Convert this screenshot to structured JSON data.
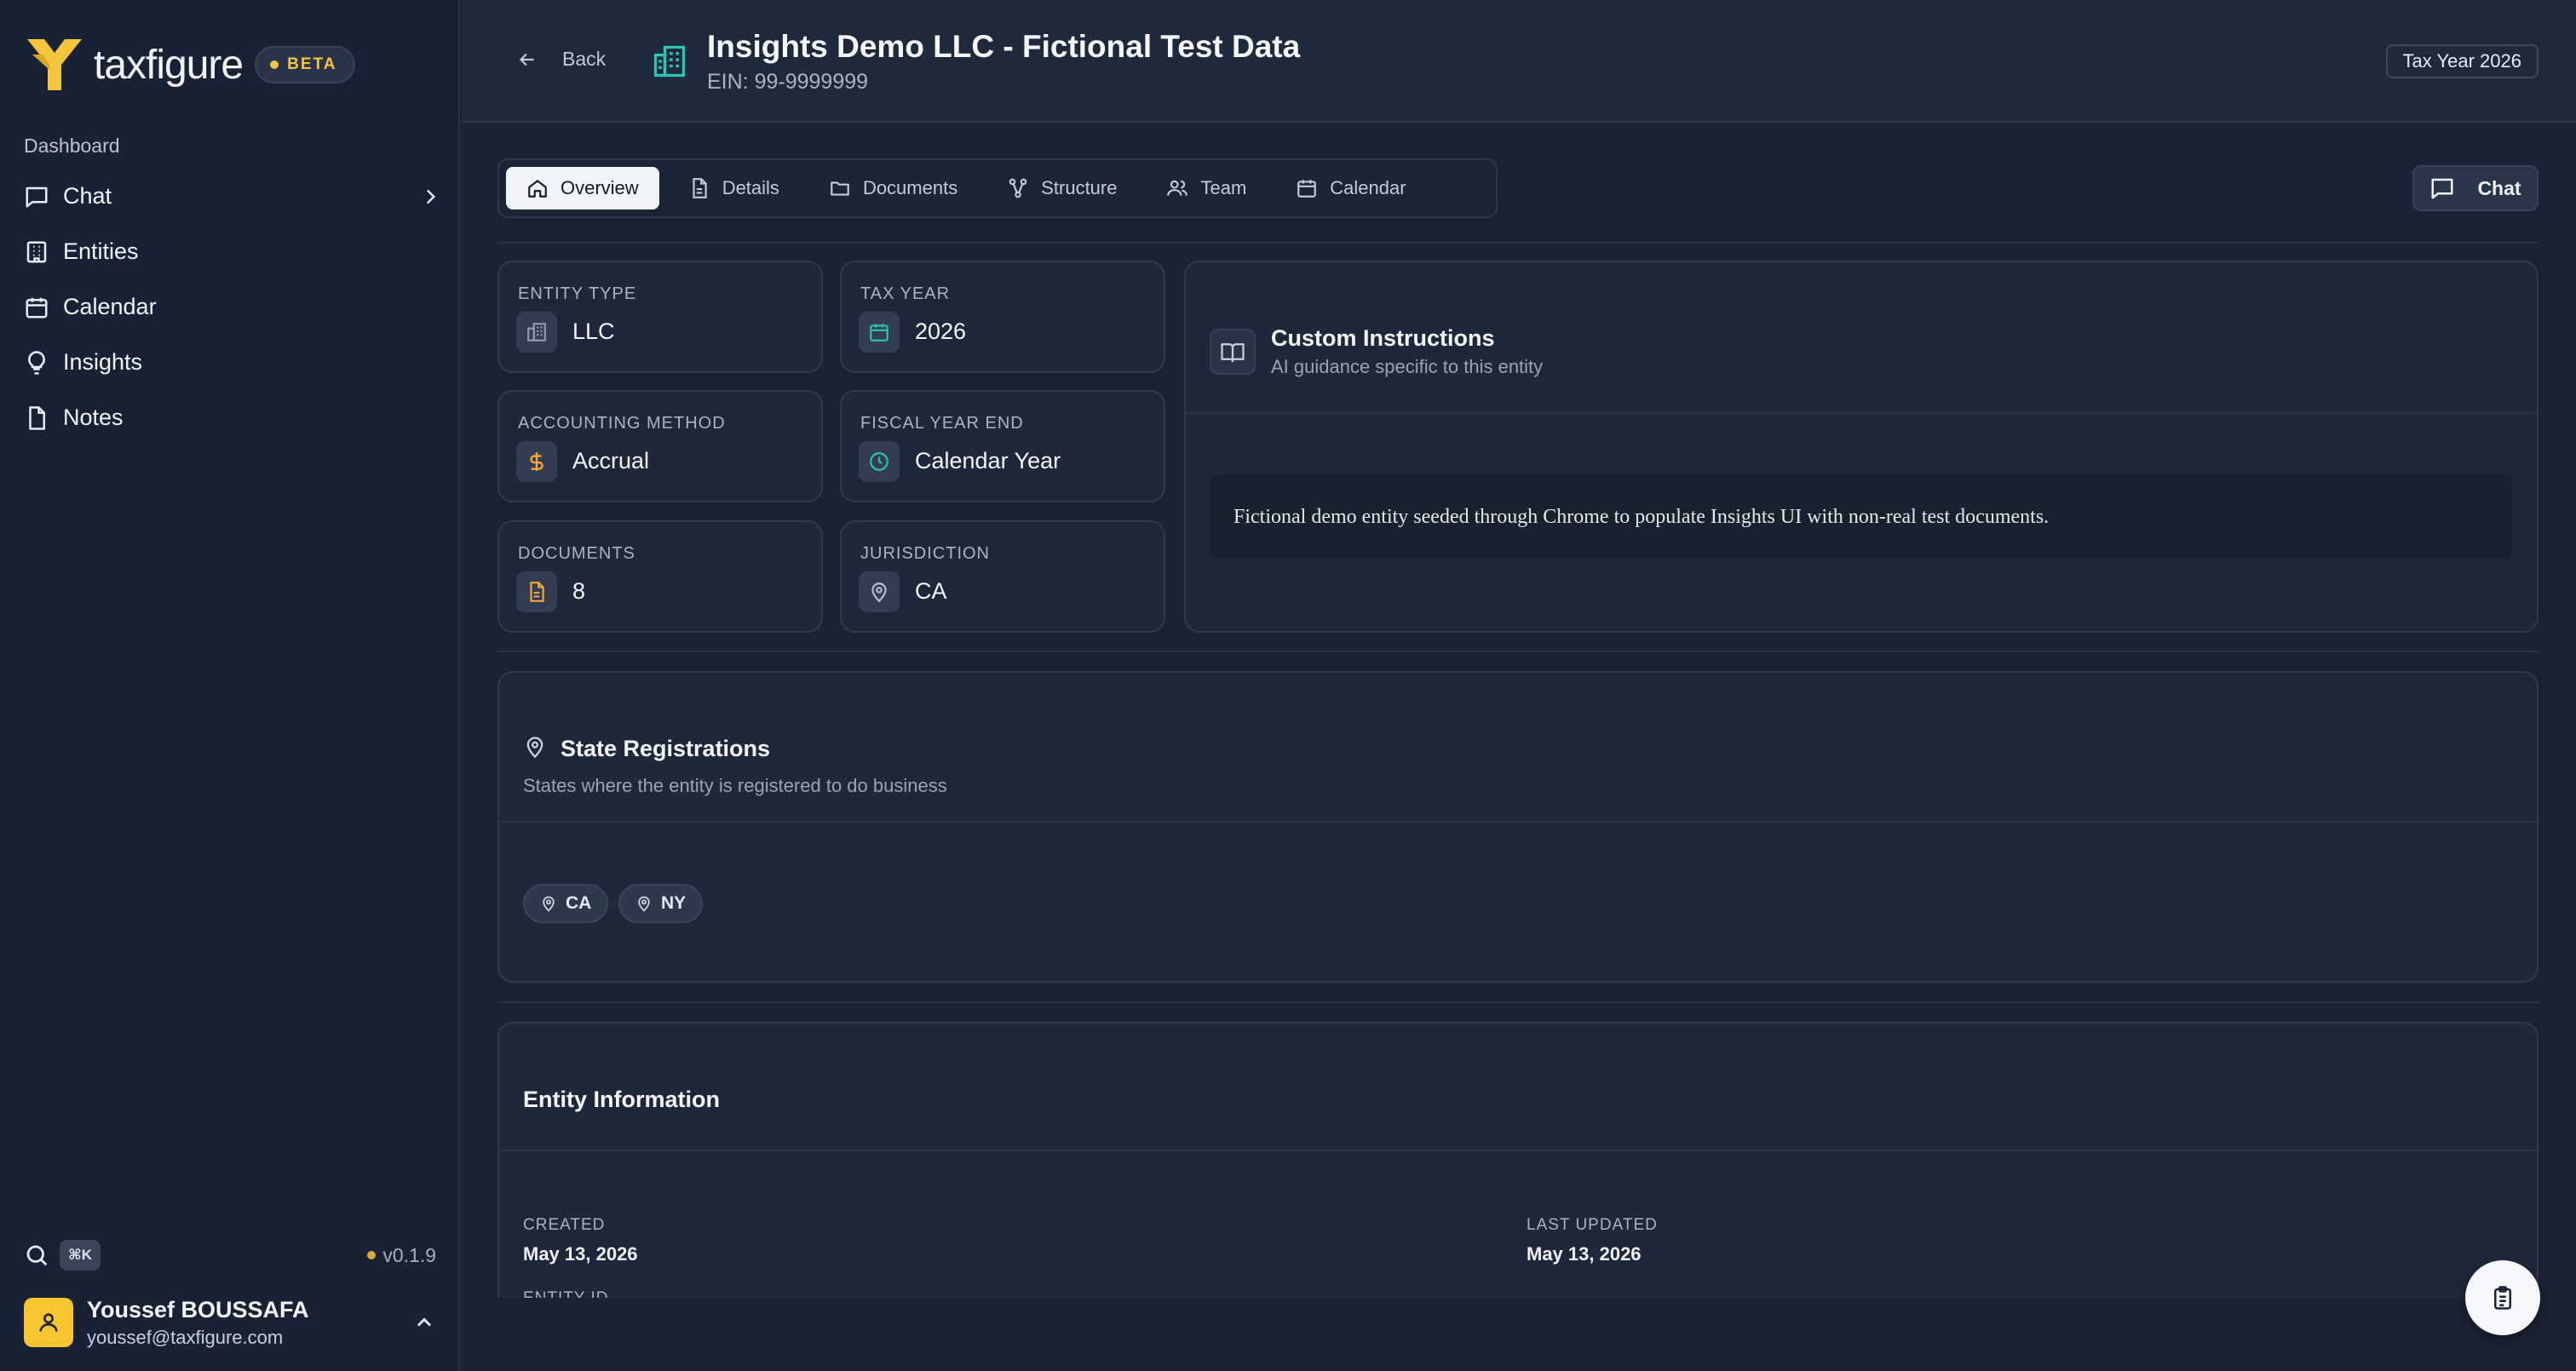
{
  "brand": {
    "name": "taxfigure",
    "badge": "BETA",
    "accent": "#f3c53a"
  },
  "sidebar": {
    "section_label": "Dashboard",
    "items": [
      {
        "label": "Chat",
        "icon": "message-square-icon",
        "has_chevron": true
      },
      {
        "label": "Entities",
        "icon": "building-icon"
      },
      {
        "label": "Calendar",
        "icon": "calendar-icon"
      },
      {
        "label": "Insights",
        "icon": "lightbulb-icon"
      },
      {
        "label": "Notes",
        "icon": "file-icon"
      }
    ],
    "search_shortcut": "⌘K",
    "version": "v0.1.9",
    "user": {
      "name": "Youssef BOUSSAFA",
      "email": "youssef@taxfigure.com"
    }
  },
  "header": {
    "back_label": "Back",
    "title": "Insights Demo LLC - Fictional Test Data",
    "ein": "EIN: 99-9999999",
    "tax_year_badge": "Tax Year 2026"
  },
  "tabs": [
    {
      "label": "Overview",
      "active": true
    },
    {
      "label": "Details"
    },
    {
      "label": "Documents"
    },
    {
      "label": "Structure"
    },
    {
      "label": "Team"
    },
    {
      "label": "Calendar"
    }
  ],
  "chat_button": "Chat",
  "stats": [
    {
      "label": "ENTITY TYPE",
      "value": "LLC",
      "icon_color": "#8f9aad"
    },
    {
      "label": "TAX YEAR",
      "value": "2026",
      "icon_color": "#2cc4b0"
    },
    {
      "label": "ACCOUNTING METHOD",
      "value": "Accrual",
      "icon_color": "#f1a838"
    },
    {
      "label": "FISCAL YEAR END",
      "value": "Calendar Year",
      "icon_color": "#2cc4b0"
    },
    {
      "label": "DOCUMENTS",
      "value": "8",
      "icon_color": "#f1a838"
    },
    {
      "label": "JURISDICTION",
      "value": "CA",
      "icon_color": "#b5bfcf"
    }
  ],
  "custom_instructions": {
    "title": "Custom Instructions",
    "subtitle": "AI guidance specific to this entity",
    "text": "Fictional demo entity seeded through Chrome to populate Insights UI with non-real test documents."
  },
  "state_registrations": {
    "title": "State Registrations",
    "subtitle": "States where the entity is registered to do business",
    "states": [
      "CA",
      "NY"
    ]
  },
  "entity_information": {
    "title": "Entity Information",
    "created_label": "CREATED",
    "created_value": "May 13, 2026",
    "updated_label": "LAST UPDATED",
    "updated_value": "May 13, 2026",
    "entity_id_label": "ENTITY ID"
  }
}
